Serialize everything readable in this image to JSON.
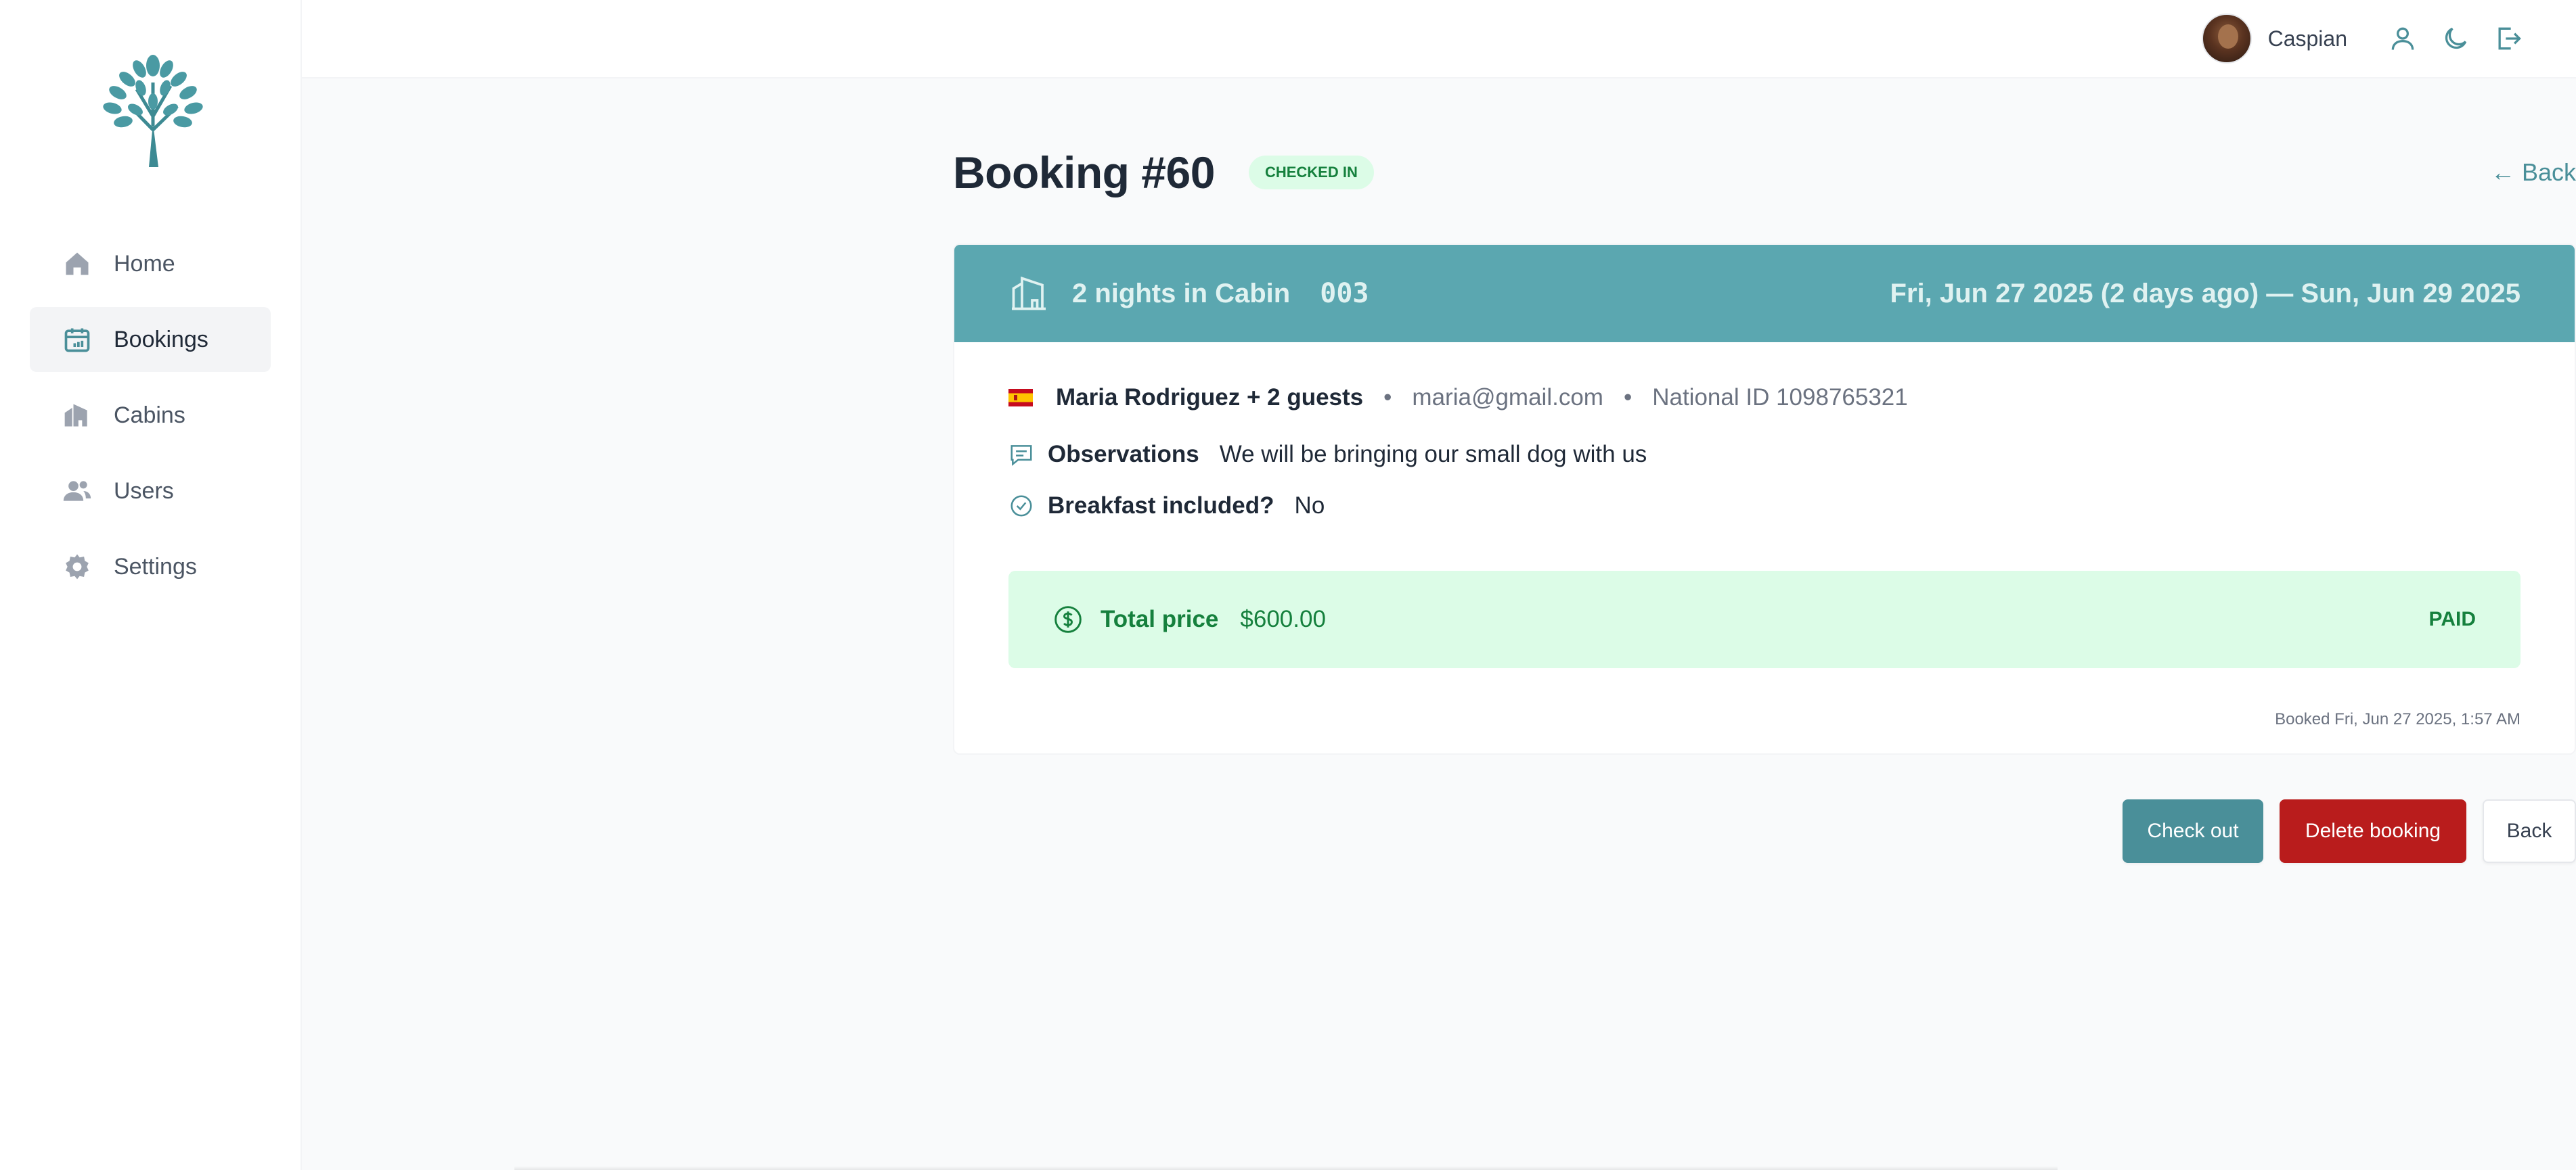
{
  "sidebar": {
    "items": [
      {
        "label": "Home",
        "icon": "home-icon"
      },
      {
        "label": "Bookings",
        "icon": "calendar-icon",
        "active": true
      },
      {
        "label": "Cabins",
        "icon": "building-icon"
      },
      {
        "label": "Users",
        "icon": "users-icon"
      },
      {
        "label": "Settings",
        "icon": "gear-icon"
      }
    ]
  },
  "header": {
    "username": "Caspian",
    "icons": [
      "user-icon",
      "moon-icon",
      "logout-icon"
    ]
  },
  "booking": {
    "title": "Booking #60",
    "status": "Checked in",
    "back_link": "← Back",
    "nights_text": "2 nights in Cabin",
    "cabin_code": "003",
    "date_range": "Fri, Jun 27 2025 (2 days ago) — Sun, Jun 29 2025",
    "guest_name": "Maria Rodriguez + 2 guests",
    "guest_email": "maria@gmail.com",
    "national_id": "National ID 1098765321",
    "observations_label": "Observations",
    "observations_value": "We will be bringing our small dog with us",
    "breakfast_label": "Breakfast included?",
    "breakfast_value": "No",
    "price_label": "Total price",
    "price_value": "$600.00",
    "paid_label": "Paid",
    "booked_at": "Booked Fri, Jun 27 2025, 1:57 AM"
  },
  "actions": {
    "check_out": "Check out",
    "delete": "Delete booking",
    "back": "Back"
  },
  "colors": {
    "brand": "#4a8f99",
    "header_band": "#5ba7b0",
    "danger": "#b91c1c",
    "success_bg": "#dcfce7",
    "success_text": "#15803d"
  }
}
